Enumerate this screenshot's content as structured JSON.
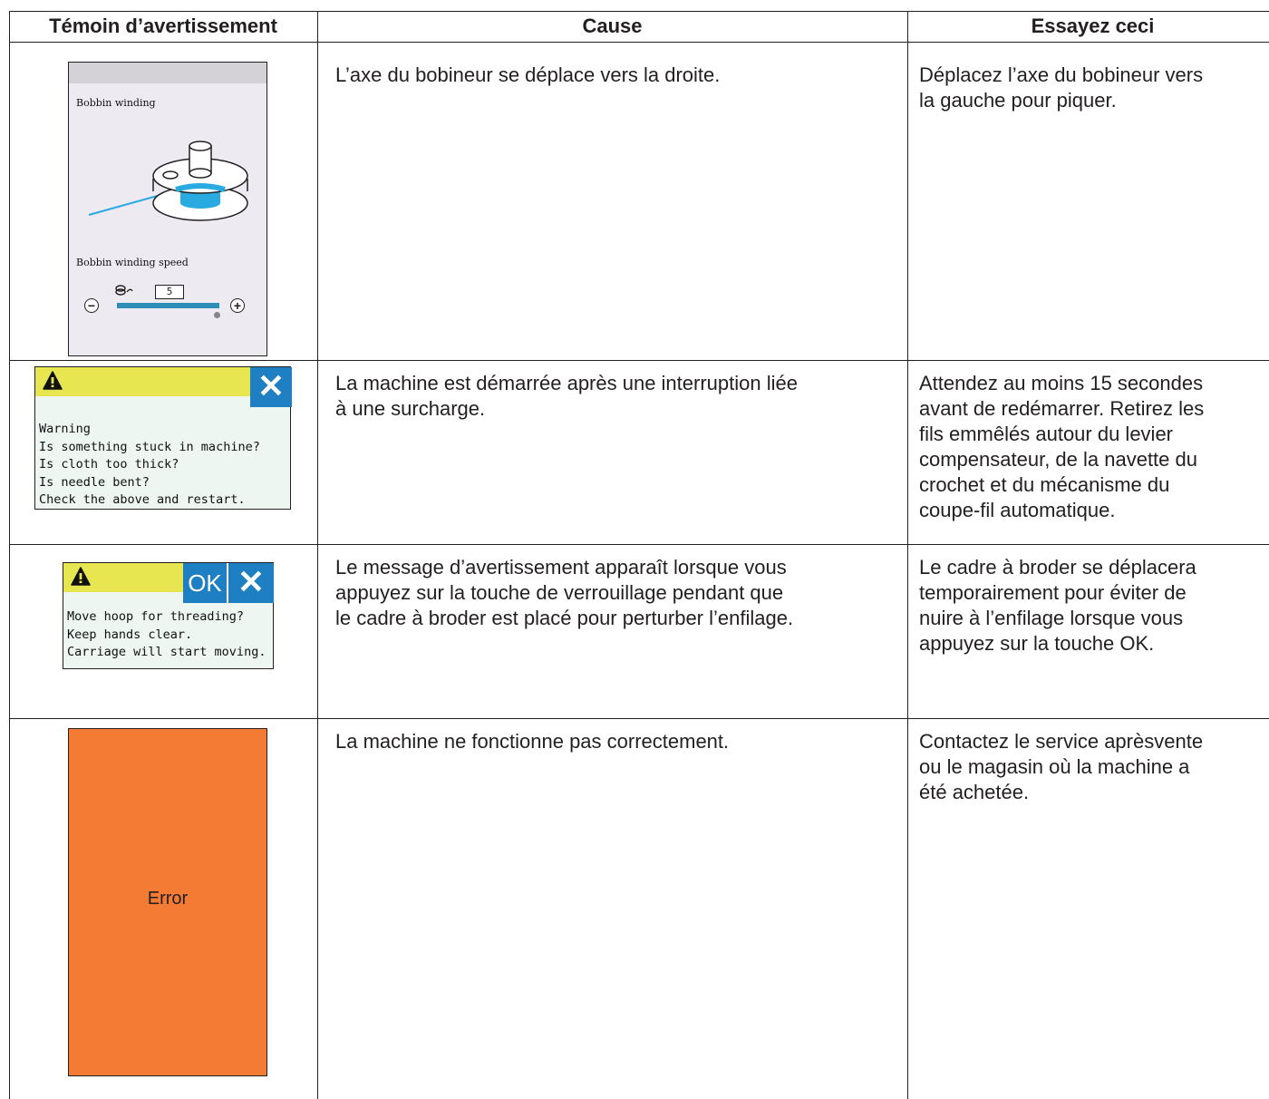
{
  "table": {
    "headers": {
      "indicator": "Témoin d’avertissement",
      "cause": "Cause",
      "remedy": "Essayez ceci"
    },
    "rows": [
      {
        "cause": "L’axe du bobineur se déplace vers la droite.",
        "remedy": "Déplacez l’axe du bobineur vers\nla gauche pour piquer."
      },
      {
        "cause": "La machine est démarrée après une interruption liée\nà une surcharge.",
        "remedy": "Attendez au moins 15 secondes\navant de redémarrer. Retirez les\nfils emmêlés autour du levier\ncompensateur, de la navette du\ncrochet et du mécanisme du\ncoupe-fil automatique."
      },
      {
        "cause": "Le message d’avertissement apparaît lorsque vous\nappuyez sur la touche de verrouillage pendant que\nle cadre à broder est placé pour perturber l’enfilage.",
        "remedy": "Le cadre à broder se déplacera\ntemporairement pour éviter de\nnuire à l’enfilage lorsque vous\nappuyez sur la touche OK."
      },
      {
        "cause": "La machine ne fonctionne pas correctement.",
        "remedy": "Contactez le service aprèsvente\nou le magasin où la machine a\nété achetée."
      }
    ]
  },
  "screens": {
    "bobbin": {
      "title": "Bobbin winding",
      "speed_label": "Bobbin winding speed",
      "speed_value": "5",
      "minus": "−",
      "plus": "+",
      "speed_icon": "bobbin-speed-icon",
      "speed_level": 1.0,
      "accent_color": "#29abe2"
    },
    "overload": {
      "lines": [
        "Warning",
        "Is something stuck in machine?",
        "Is cloth too thick?",
        "Is needle bent?",
        "Check the above and restart."
      ],
      "close_icon": "close-icon",
      "warning_icon": "warning-triangle-icon"
    },
    "hoop": {
      "ok_label": "OK",
      "lines": [
        "Move hoop for threading?",
        "Keep hands clear.",
        "Carriage will start moving."
      ],
      "close_icon": "close-icon",
      "warning_icon": "warning-triangle-icon"
    },
    "error": {
      "label": "Error",
      "color": "#f47b33"
    }
  }
}
